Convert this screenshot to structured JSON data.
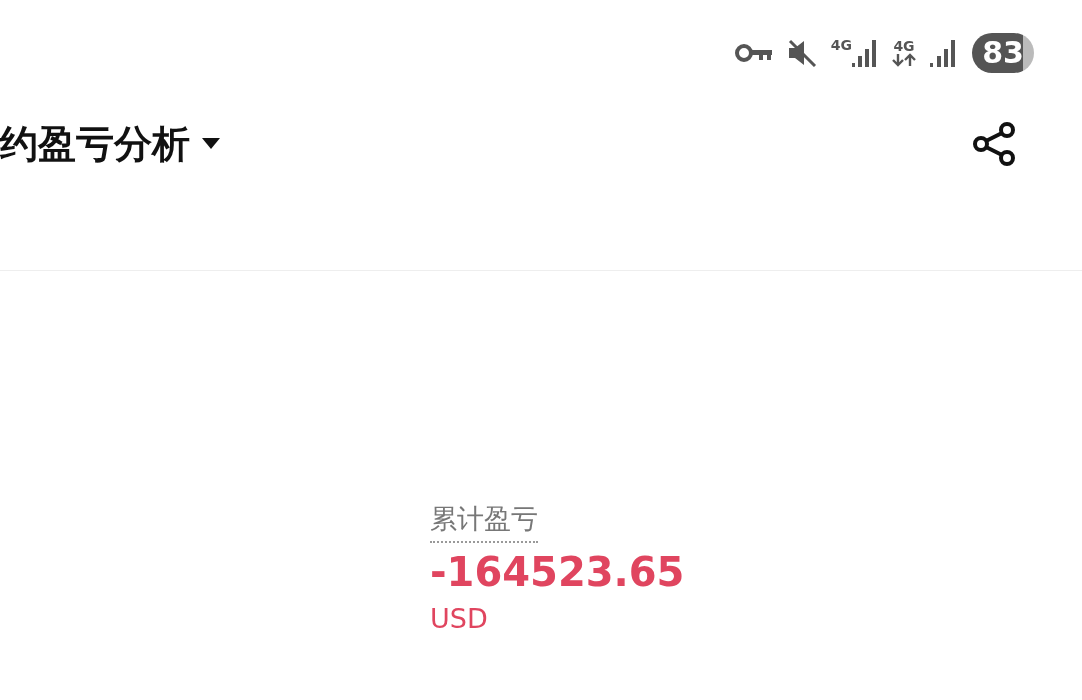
{
  "status_bar": {
    "network_1": "4G",
    "network_2": "4G",
    "battery": "83"
  },
  "header": {
    "title": "约盈亏分析"
  },
  "summary": {
    "label": "累计盈亏",
    "value": "-164523.65",
    "currency": "USD"
  }
}
